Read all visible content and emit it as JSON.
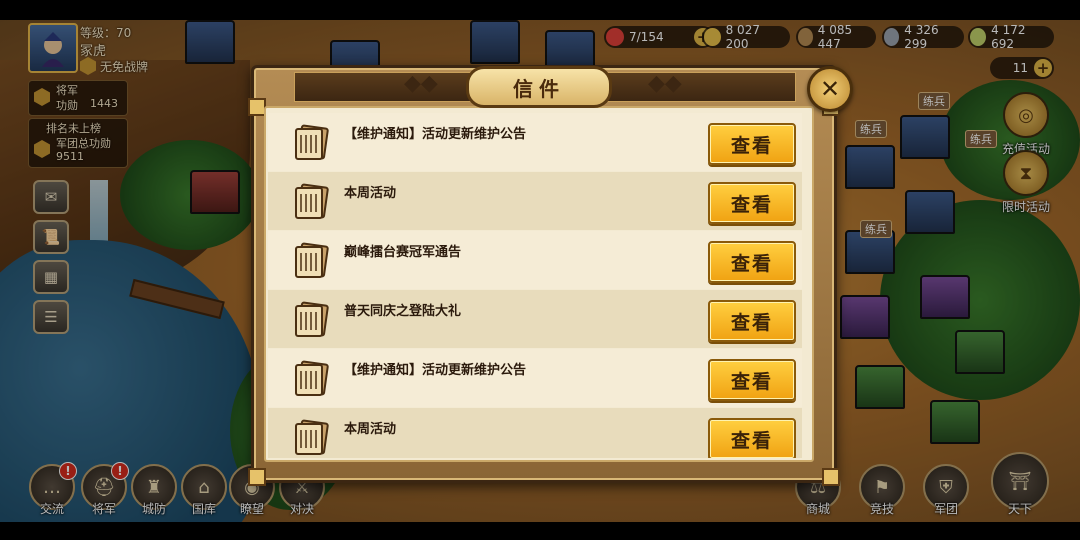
{
  "player": {
    "level_label": "等级：70",
    "name": "冢虎",
    "war_status": "无免战牌",
    "title": "将军",
    "merit_label": "功勋",
    "merit_value": "1443",
    "rank_text": "排名未上榜",
    "legion_merit_label": "军团总功勋",
    "legion_merit_value": "9511"
  },
  "resources": [
    {
      "icon": "stamina-icon",
      "value": "7/154",
      "color": "#e0413a"
    },
    {
      "icon": "gold-coin-icon",
      "value": "8 027 200",
      "color": "#e8c04a"
    },
    {
      "icon": "wood-icon",
      "value": "4 085 447",
      "color": "#b38a52"
    },
    {
      "icon": "ore-icon",
      "value": "4 326 299",
      "color": "#9aa3ad"
    },
    {
      "icon": "food-icon",
      "value": "4 172 692",
      "color": "#bfd06a"
    }
  ],
  "gem_value": "11",
  "map_tags": [
    "练兵",
    "练兵",
    "练兵",
    "练兵"
  ],
  "right_buttons": [
    {
      "id": "recharge",
      "label": "充值活动",
      "icon": "coins-icon"
    },
    {
      "id": "limited",
      "label": "限时活动",
      "icon": "hourglass-icon"
    }
  ],
  "bottom_left_nav": [
    {
      "id": "chat",
      "label": "交流",
      "alert": "!"
    },
    {
      "id": "general",
      "label": "将军",
      "alert": "!"
    },
    {
      "id": "defense",
      "label": "城防",
      "alert": ""
    },
    {
      "id": "treasury",
      "label": "国库",
      "alert": ""
    },
    {
      "id": "watch",
      "label": "瞭望",
      "alert": ""
    },
    {
      "id": "duel",
      "label": "对决",
      "alert": ""
    }
  ],
  "bottom_right_nav": [
    {
      "id": "shop",
      "label": "商城"
    },
    {
      "id": "compete",
      "label": "竞技"
    },
    {
      "id": "legion",
      "label": "军团"
    },
    {
      "id": "world",
      "label": "天下"
    }
  ],
  "dialog": {
    "title": "信件",
    "close_glyph": "✕",
    "view_label": "查看",
    "mails": [
      {
        "subject": "【维护通知】活动更新维护公告"
      },
      {
        "subject": "本周活动"
      },
      {
        "subject": "巅峰擂台赛冠军通告"
      },
      {
        "subject": "普天同庆之登陆大礼"
      },
      {
        "subject": "【维护通知】活动更新维护公告"
      },
      {
        "subject": "本周活动"
      }
    ]
  }
}
